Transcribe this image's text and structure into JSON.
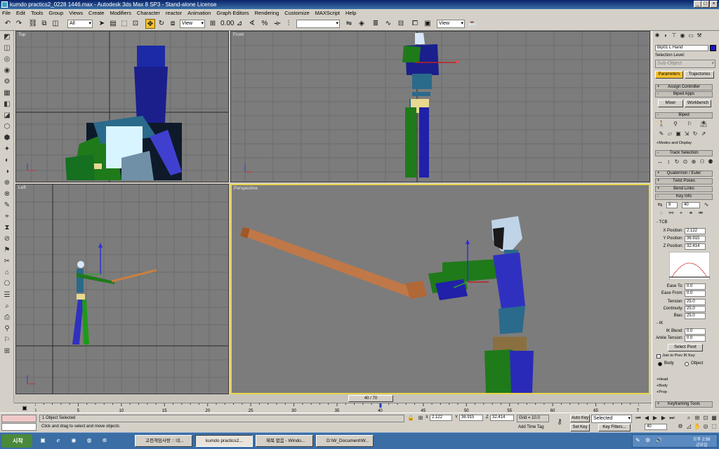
{
  "window": {
    "title": "kumdo practics2_0228 1446.max - Autodesk 3ds Max 8 SP3 - Stand-alone License"
  },
  "menu": [
    "File",
    "Edit",
    "Tools",
    "Group",
    "Views",
    "Create",
    "Modifiers",
    "Character",
    "reactor",
    "Animation",
    "Graph Editors",
    "Rendering",
    "Customize",
    "MAXScript",
    "Help"
  ],
  "toolbar": {
    "selection_filter": "All",
    "ref_coord": "View",
    "snap_value": "0.00",
    "named_selection": "",
    "ref_coord2": "View"
  },
  "viewports": {
    "top": "Top",
    "front": "Front",
    "left": "Left",
    "perspective": "Perspective"
  },
  "command_panel": {
    "object_name": "Bip01 L Hand",
    "object_color": "#1a1ab8",
    "selection_level_label": "Selection Level:",
    "sub_object": "Sub-Object",
    "tabs": {
      "parameters": "Parameters",
      "trajectories": "Trajectories"
    },
    "rollouts": {
      "assign_controller": "Assign Controller",
      "biped_apps": "Biped Apps",
      "biped": "Biped",
      "track_selection": "Track Selection",
      "quaternion_euler": "Quaternion / Euler",
      "twist_poses": "Twist Poses",
      "bend_links": "Bend Links",
      "key_info": "Key Info",
      "keyframing_tools": "Keyframing Tools"
    },
    "buttons": {
      "mixer": "Mixer",
      "workbench": "Workbench",
      "select_pivot": "Select Pivot"
    },
    "modes_and_display": "+Modes and Display",
    "key_info": {
      "key_number": "8",
      "frame": "40"
    },
    "tcb": {
      "section": "- TCB",
      "x_label": "X Position:",
      "x": "2.122",
      "y_label": "Y Position:",
      "y": "36.915",
      "z_label": "Z Position:",
      "z": "32.414",
      "ease_to_label": "Ease To:",
      "ease_to": "0.0",
      "ease_from_label": "Ease From:",
      "ease_from": "0.0",
      "tension_label": "Tension:",
      "tension": "25.0",
      "continuity_label": "Continuity:",
      "continuity": "25.0",
      "bias_label": "Bias:",
      "bias": "25.0"
    },
    "ik": {
      "section": "- IK",
      "ik_blend_label": "IK Blend:",
      "ik_blend": "0.0",
      "ankle_tension_label": "Ankle Tension:",
      "ankle_tension": "0.0",
      "join_prev": "Join to Prev IK Key",
      "body": "Body",
      "object": "Object"
    },
    "extras": {
      "head": "+Head",
      "body": "+Body",
      "prop": "+Prop"
    }
  },
  "timeline": {
    "frame_display": "40 / 70",
    "ticks": [
      "0",
      "5",
      "10",
      "15",
      "20",
      "25",
      "30",
      "35",
      "40",
      "45",
      "50",
      "55",
      "60",
      "65",
      "70"
    ],
    "current_frame": 40,
    "total_frames": 70
  },
  "status": {
    "selection": "1 Object Selected",
    "prompt": "Click and drag to select and move objects",
    "x_label": "X",
    "x": "2.122",
    "y_label": "Y",
    "y": "36.915",
    "z_label": "Z",
    "z": "32.414",
    "grid": "Grid = 10.0",
    "add_time_tag": "Add Time Tag",
    "auto_key": "Auto Key",
    "set_key": "Set Key",
    "selected": "Selected",
    "key_filters": "Key Filters...",
    "frame": "40"
  },
  "taskbar": {
    "start": "시작",
    "tasks": [
      "고전게임사랑 :: 네...",
      "kumdo practics2...",
      "제목 없음 - Windo...",
      "D:\\W_Document\\W..."
    ],
    "clock_line1": "오후 2:58",
    "clock_line2": "금요일"
  }
}
